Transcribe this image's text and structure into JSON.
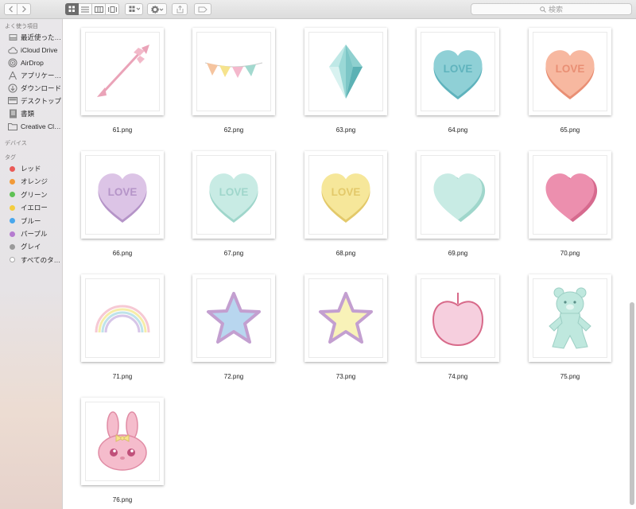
{
  "toolbar": {
    "search_placeholder": "検索"
  },
  "sidebar": {
    "favorites_header": "よく使う項目",
    "favorites": [
      {
        "label": "最近使った…",
        "icon": "recents-icon"
      },
      {
        "label": "iCloud Drive",
        "icon": "cloud-icon"
      },
      {
        "label": "AirDrop",
        "icon": "airdrop-icon"
      },
      {
        "label": "アプリケー…",
        "icon": "applications-icon"
      },
      {
        "label": "ダウンロード",
        "icon": "download-icon"
      },
      {
        "label": "デスクトップ",
        "icon": "desktop-icon"
      },
      {
        "label": "書類",
        "icon": "documents-icon"
      },
      {
        "label": "Creative Cl…",
        "icon": "folder-icon"
      }
    ],
    "devices_header": "デバイス",
    "tags_header": "タグ",
    "tags": [
      {
        "label": "レッド",
        "color": "#ea5a57"
      },
      {
        "label": "オレンジ",
        "color": "#f29a38"
      },
      {
        "label": "グリーン",
        "color": "#5fc155"
      },
      {
        "label": "イエロー",
        "color": "#f4cd3f"
      },
      {
        "label": "ブルー",
        "color": "#49a7ec"
      },
      {
        "label": "パープル",
        "color": "#b57bd0"
      },
      {
        "label": "グレイ",
        "color": "#9a9a9a"
      },
      {
        "label": "すべてのタ…",
        "color": "all"
      }
    ]
  },
  "files": [
    {
      "name": "61.png",
      "art": "arrow"
    },
    {
      "name": "62.png",
      "art": "bunting"
    },
    {
      "name": "63.png",
      "art": "crystal"
    },
    {
      "name": "64.png",
      "art": "heart-love",
      "color": "#8fd0d6",
      "shade": "#5fb3bd",
      "text": "LOVE"
    },
    {
      "name": "65.png",
      "art": "heart-love",
      "color": "#f7b8a0",
      "shade": "#e98f74",
      "text": "LOVE"
    },
    {
      "name": "66.png",
      "art": "heart-love",
      "color": "#dcc4e6",
      "shade": "#b594c8",
      "text": "LOVE"
    },
    {
      "name": "67.png",
      "art": "heart-love",
      "color": "#c8ebe4",
      "shade": "#9fd6cb",
      "text": "LOVE"
    },
    {
      "name": "68.png",
      "art": "heart-love",
      "color": "#f6e79a",
      "shade": "#e3c96a",
      "text": "LOVE"
    },
    {
      "name": "69.png",
      "art": "heart",
      "color": "#c8ebe4",
      "shade": "#9fd6cb"
    },
    {
      "name": "70.png",
      "art": "heart",
      "color": "#ec8fae",
      "shade": "#d66a8e"
    },
    {
      "name": "71.png",
      "art": "rainbow"
    },
    {
      "name": "72.png",
      "art": "star",
      "color": "#b8d6ef",
      "stroke": "#c39fd0"
    },
    {
      "name": "73.png",
      "art": "star",
      "color": "#f8f2b8",
      "stroke": "#c39fd0"
    },
    {
      "name": "74.png",
      "art": "apple"
    },
    {
      "name": "75.png",
      "art": "bear"
    },
    {
      "name": "76.png",
      "art": "bunny"
    }
  ]
}
